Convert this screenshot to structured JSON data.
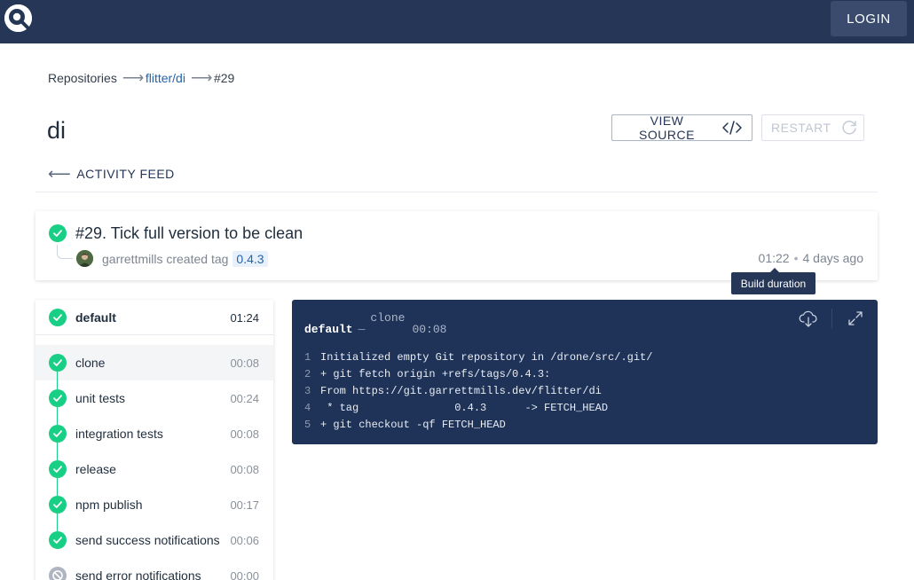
{
  "nav": {
    "login_label": "LOGIN"
  },
  "breadcrumb": {
    "root": "Repositories",
    "repo": "flitter/di",
    "build": "#29"
  },
  "repo": {
    "title": "di"
  },
  "actions": {
    "view_source": "VIEW SOURCE",
    "restart": "RESTART"
  },
  "activity_feed_label": "ACTIVITY FEED",
  "build": {
    "title": "#29. Tick full version to be clean",
    "author": "garrettmills",
    "action": "created tag",
    "tag": "0.4.3",
    "duration": "01:22",
    "dot": "•",
    "ago": "4 days ago",
    "tooltip": "Build duration"
  },
  "stage": {
    "name": "default",
    "duration": "01:24"
  },
  "steps": [
    {
      "name": "clone",
      "duration": "00:08",
      "status": "success"
    },
    {
      "name": "unit tests",
      "duration": "00:24",
      "status": "success"
    },
    {
      "name": "integration tests",
      "duration": "00:08",
      "status": "success"
    },
    {
      "name": "release",
      "duration": "00:08",
      "status": "success"
    },
    {
      "name": "npm publish",
      "duration": "00:17",
      "status": "success"
    },
    {
      "name": "send success notifications",
      "duration": "00:06",
      "status": "success"
    },
    {
      "name": "send error notifications",
      "duration": "00:00",
      "status": "skipped"
    }
  ],
  "log": {
    "stage": "default",
    "sep": "—",
    "step": "clone",
    "time": "00:08",
    "lines": [
      {
        "n": "1",
        "text": "Initialized empty Git repository in /drone/src/.git/"
      },
      {
        "n": "2",
        "text": "+ git fetch origin +refs/tags/0.4.3:"
      },
      {
        "n": "3",
        "text": "From https://git.garrettmills.dev/flitter/di"
      },
      {
        "n": "4",
        "text": " * tag               0.4.3      -> FETCH_HEAD"
      },
      {
        "n": "5",
        "text": "+ git checkout -qf FETCH_HEAD"
      }
    ]
  },
  "colors": {
    "nav_bg": "#253657",
    "success": "#19cf86",
    "skipped": "#aeb5c1",
    "log_bg": "#1f3359",
    "link": "#2364ad"
  }
}
